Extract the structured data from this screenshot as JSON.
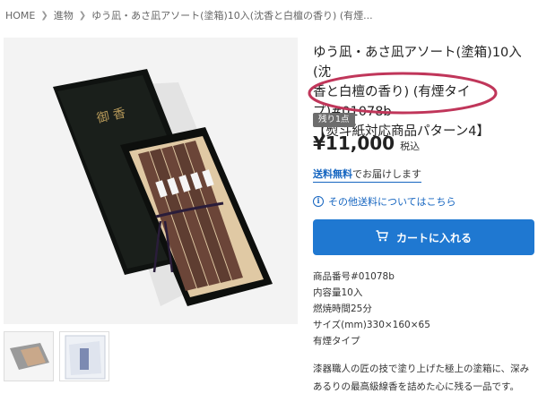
{
  "breadcrumb": {
    "home": "HOME",
    "category": "進物",
    "current": "ゆう凪・あさ凪アソート(塗箱)10入(沈香と白檀の香り) (有煙..."
  },
  "product": {
    "title_line1": "ゆう凪・あさ凪アソート(塗箱)10入(沈",
    "title_line2": "香と白檀の香り) (有煙タイプ)#01078b",
    "title_line3": "【熨斗紙対応商品パターン4】",
    "stock_badge": "残り1点",
    "price": "¥11,000",
    "tax_label": "税込",
    "shipping_bold": "送料無料",
    "shipping_rest": "でお届けします",
    "other_shipping": "その他送料についてはこちら",
    "cart_label": "カートに入れる",
    "specs": [
      "商品番号#01078b",
      "内容量10入",
      "燃焼時間25分",
      "サイズ(mm)330×160×65",
      "有煙タイプ"
    ],
    "description": "漆器職人の匠の技で塗り上げた極上の塗箱に、深みあるりの最高級線香を詰めた心に残る一品です。",
    "box_lid_text": "御 香",
    "accent_color": "#1f78d1",
    "annotation_color": "#c0365a"
  }
}
